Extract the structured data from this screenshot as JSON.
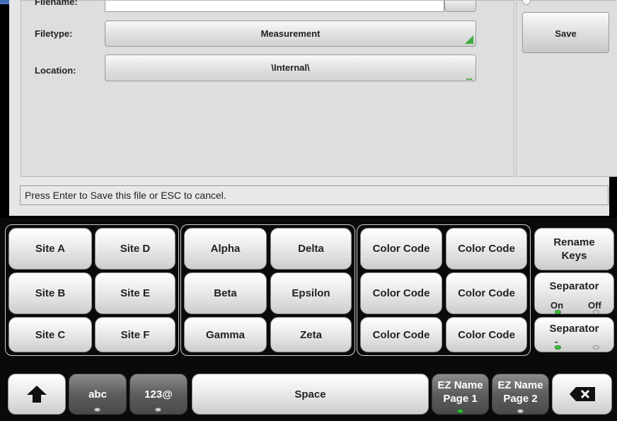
{
  "dialog": {
    "filename_label": "Filename:",
    "filetype_label": "Filetype:",
    "filetype_value": "Measurement",
    "location_label": "Location:",
    "location_value": "\\Internal\\",
    "location_dots": "...",
    "save_label": "Save",
    "status_text": "Press Enter to Save this file or ESC to cancel."
  },
  "keyboard": {
    "site_keys": [
      "Site A",
      "Site D",
      "Site B",
      "Site E",
      "Site C",
      "Site F"
    ],
    "greek_keys": [
      "Alpha",
      "Delta",
      "Beta",
      "Epsilon",
      "Gamma",
      "Zeta"
    ],
    "color_keys": [
      "Color Code",
      "Color Code",
      "Color Code",
      "Color Code",
      "Color Code",
      "Color Code"
    ],
    "rename_keys": "Rename Keys",
    "separator1": {
      "label": "Separator",
      "on": "On",
      "off": "Off"
    },
    "separator2": {
      "label": "Separator",
      "dash": "-",
      "underscore": "_"
    },
    "abc_label": "abc",
    "num_label": "123@",
    "space_label": "Space",
    "ez_page1": "EZ Name Page 1",
    "ez_page2": "EZ Name Page 2"
  },
  "colors": {
    "accent_green": "#39c439",
    "title_blue": "#4a70c0"
  }
}
